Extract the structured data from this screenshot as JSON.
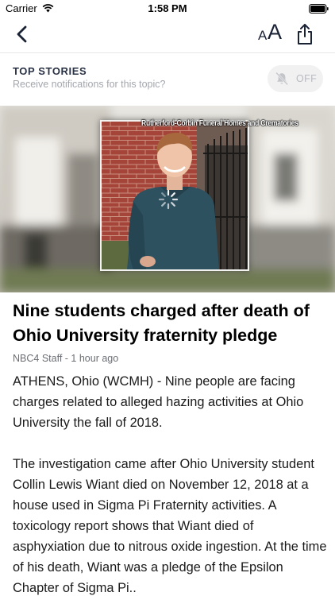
{
  "status_bar": {
    "carrier": "Carrier",
    "time": "1:58 PM"
  },
  "nav": {
    "font_small": "A",
    "font_large": "A",
    "back_icon": "chevron-left-icon",
    "share_icon": "share-icon"
  },
  "topic": {
    "title": "TOP STORIES",
    "subtitle": "Receive notifications for this topic?",
    "toggle_label": "OFF",
    "toggle_icon": "bell-slash-icon"
  },
  "hero": {
    "photo_credit": "Rutherford-Corbin Funeral Homes and Crematories"
  },
  "article": {
    "headline": "Nine students charged after death of Ohio University fraternity pledge",
    "byline": "NBC4 Staff - 1 hour ago",
    "paragraphs": [
      "ATHENS, Ohio (WCMH) - Nine people are facing charges related to alleged hazing activities at Ohio University the fall of 2018.",
      "The investigation came after Ohio University student Collin Lewis Wiant died on November 12, 2018 at a house used in Sigma Pi Fraternity activities. A toxicology report shows that Wiant died of asphyxiation due to nitrous oxide ingestion. At the time of his death, Wiant was a pledge of the Epsilon Chapter of Sigma Pi.."
    ]
  },
  "colors": {
    "nav_icon": "#1a2236",
    "topic_title": "#2a3245",
    "toggle_bg": "#f1f1f2"
  }
}
